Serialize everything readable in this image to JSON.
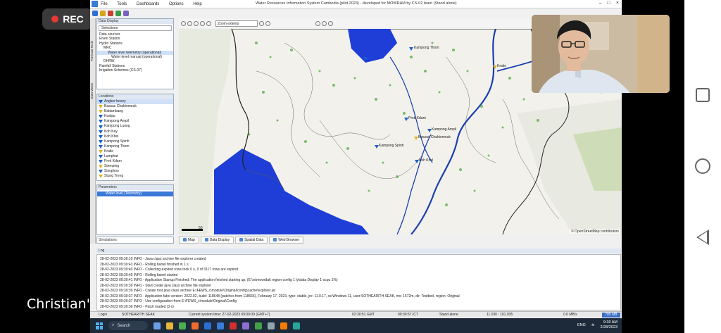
{
  "recording": {
    "label": "REC"
  },
  "caption": "Christian's",
  "window": {
    "title": "Water Resources Information System Cambodia (pilot 2023) - developed for MOWRAM by CS-02 team (Stand alone)",
    "menu": [
      "File",
      "Tools",
      "Dashboards",
      "Options",
      "Help"
    ]
  },
  "side_tabs": [
    "Forecast Tools",
    "Data Views"
  ],
  "data_display": {
    "title": "Data Display",
    "selection": "Selections",
    "tree_header": "Data sources",
    "tree": [
      {
        "label": "Elven Station",
        "level": 1
      },
      {
        "label": "Hydro Stations",
        "level": 1
      },
      {
        "label": "MRC",
        "level": 2
      },
      {
        "label": "Water level telemetry (operational)",
        "level": 3,
        "selected": true
      },
      {
        "label": "Water level manual (operational)",
        "level": 4
      },
      {
        "label": "DHRW",
        "level": 2
      },
      {
        "label": "Rainfall Stations",
        "level": 1
      },
      {
        "label": "Irrigation Schemes (CS-07)",
        "level": 1
      }
    ]
  },
  "locations": {
    "title": "Locations",
    "items": [
      {
        "label": "Angkor bovey",
        "color": "blue",
        "selected": true
      },
      {
        "label": "Bassac Chaktomouk",
        "color": "yellow"
      },
      {
        "label": "Battambang",
        "color": "yellow"
      },
      {
        "label": "Koalau",
        "color": "blue"
      },
      {
        "label": "Kampong Ampil",
        "color": "blue"
      },
      {
        "label": "Kampong Luong",
        "color": "blue"
      },
      {
        "label": "Koh Key",
        "color": "blue"
      },
      {
        "label": "Koh Khel",
        "color": "blue"
      },
      {
        "label": "Kampong Spinh",
        "color": "blue"
      },
      {
        "label": "Kampong Thom",
        "color": "blue"
      },
      {
        "label": "Kratie",
        "color": "yellow"
      },
      {
        "label": "Lumphat",
        "color": "blue"
      },
      {
        "label": "Prek Kdam",
        "color": "blue"
      },
      {
        "label": "Stemping",
        "color": "yellow"
      },
      {
        "label": "Sisophon",
        "color": "blue"
      },
      {
        "label": "Stung Treng",
        "color": "yellow"
      }
    ]
  },
  "parameters": {
    "title": "Parameters",
    "selected": "Water level (Telemetry)"
  },
  "simulations": {
    "title": "Simulations"
  },
  "map": {
    "zoom_label": "Zoom extents",
    "attribution": "© OpenStreetMap contributors",
    "scale_label": "50",
    "labels": [
      {
        "text": "Kampong Thom"
      },
      {
        "text": "Kratie"
      },
      {
        "text": "Prek Kdam"
      },
      {
        "text": "Kampong Ampil"
      },
      {
        "text": "Kampong Spinh"
      },
      {
        "text": "Bassac Chaktomouk"
      },
      {
        "text": "Koh Khel"
      }
    ]
  },
  "tabs": [
    {
      "label": "Map"
    },
    {
      "label": "Data Display"
    },
    {
      "label": "Spatial Data"
    },
    {
      "label": "Web Browser"
    }
  ],
  "log": {
    "title": "Log",
    "lines": [
      "28-02-2023 09:30:10  INFO - Java class archive file explorer created",
      "28-02-2023 09:30:43  INFO - Rolling barrel finished in 1 s",
      "28-02-2023 09:30:40  INFO - Collecting expired rows took 0 s, 0 of 3117 rows are expired",
      "28-02-2023 09:30:40  INFO - Rolling barrel started",
      "28-02-2023 09:30:41  INFO - Application Startup Finished. The application finished starting up. (E:\\rs\\mowrdat\\ region config 1 ly\\data Display 1 ocpu 1%)",
      "28-02-2023 09:30:39  INFO - Start create java class archive file explorer",
      "28-02-2023 09:30:39  INFO - Create root java class archive E:\\FEWS_c\\module\\Original\\config\\cache\\explorer.jar",
      "28-02-2023 09:30:37  INFO - Application fabc version: 2022.02, build: 118648 (patches from 118666), February 17, 2023, type: stable, jre: 11.0.17, os:Windows 11, user:SOTHEARITH SEAK, mx: 1572m, dir: Testbed, region: Original",
      "28-02-2023 09:30:37  INFO - Use configuration from E:\\FEWS_c\\module\\Original\\Config",
      "28-02-2023 09:30:36  INFO - Patch loaded (3 s)"
    ]
  },
  "status": {
    "left": "Login",
    "user": "SOTHEARITH SEAK",
    "system_time": "Current system time: 27-02-2023 09:00:00 (GMT+7)",
    "gmt": "02:30:51 GMT",
    "ict": "09:30:57 ICT",
    "mode": "Stand alone",
    "coords": "11.030 : 101.935",
    "rate": "0.0 MB/s",
    "memory": "789 MB"
  },
  "taskbar": {
    "search": "Search",
    "lang": "ENG",
    "time": "9:30 AM",
    "date": "2/28/2023"
  }
}
